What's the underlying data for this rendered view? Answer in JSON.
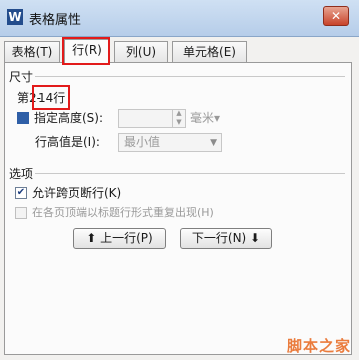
{
  "window": {
    "title": "表格属性",
    "app_icon": "W",
    "close_glyph": "✕"
  },
  "tabs": [
    {
      "label": "表格(T)"
    },
    {
      "label": "行(R)"
    },
    {
      "label": "列(U)"
    },
    {
      "label": "单元格(E)"
    }
  ],
  "size_section": {
    "heading": "尺寸",
    "row_prefix": "第2-",
    "row_range": "14行",
    "specify_height_label": "指定高度(S):",
    "height_value": "",
    "unit_label": "毫米▾",
    "row_height_is_label": "行高值是(I):",
    "row_height_mode": "最小值"
  },
  "options_section": {
    "heading": "选项",
    "allow_break_label": "允许跨页断行(K)",
    "repeat_header_label": "在各页顶端以标题行形式重复出现(H)"
  },
  "nav": {
    "prev_row": "⬆ 上一行(P)",
    "next_row": "下一行(N) ⬇"
  },
  "watermark": "脚本之家"
}
